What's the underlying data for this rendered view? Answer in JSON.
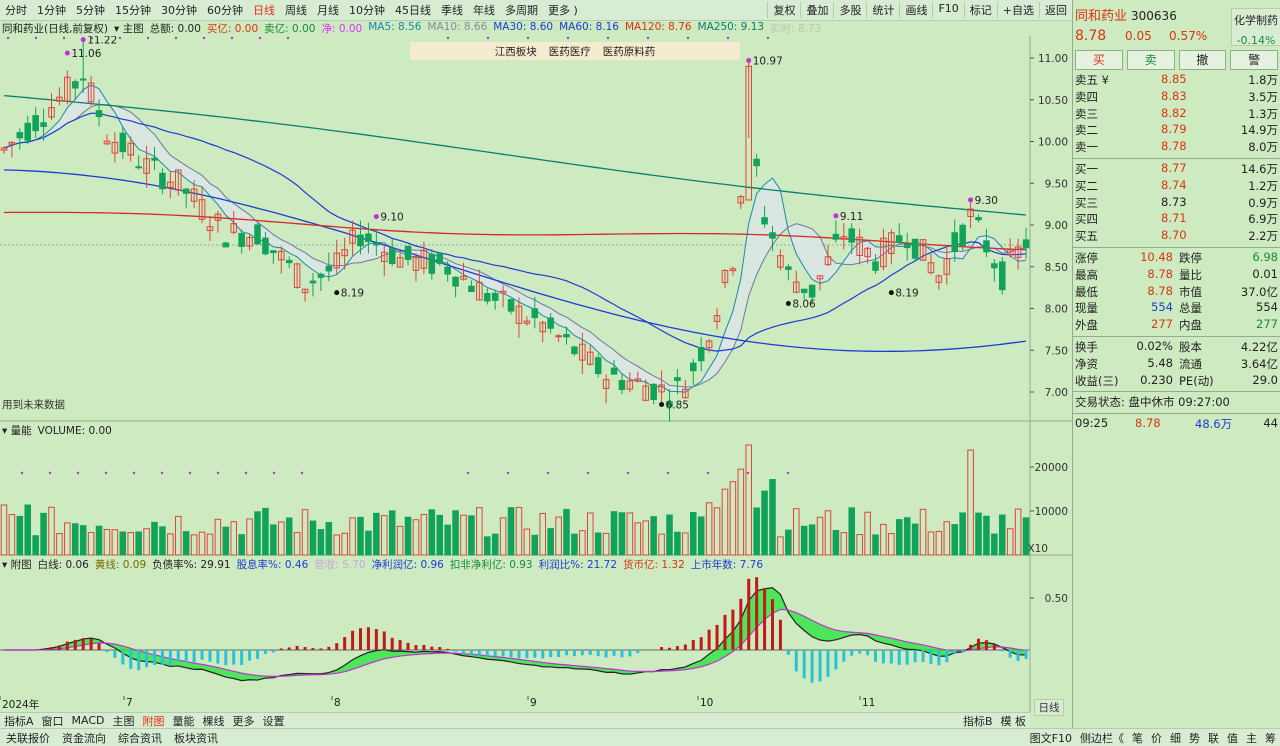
{
  "topbar": {
    "periods": [
      "分时",
      "1分钟",
      "5分钟",
      "15分钟",
      "30分钟",
      "60分钟",
      "日线",
      "周线",
      "月线",
      "10分钟",
      "45日线",
      "季线",
      "年线",
      "多周期",
      "更多 )"
    ],
    "active": "日线",
    "right": [
      "复权",
      "叠加",
      "多股",
      "统计",
      "画线",
      "F10",
      "标记",
      "+自选",
      "返回"
    ]
  },
  "legend": {
    "title": "同和药业(日线,前复权)",
    "zhutu": "▾ 主图",
    "zonge": "总额: 0.00",
    "mai": "买亿: 0.00",
    "mai2": "卖亿: 0.00",
    "jing": "净: 0.00",
    "ma5": "MA5: 8.56",
    "ma10": "MA10: 8.66",
    "ma30": "MA30: 8.60",
    "ma60": "MA60: 8.16",
    "ma120": "MA120: 8.76",
    "ma250": "MA250: 9.13",
    "shishi": "实时: 8.73"
  },
  "board": [
    "江西板块",
    "医药医疗",
    "医药原料药"
  ],
  "chart_data": {
    "type": "candlestick",
    "price_axis": [
      "11.00",
      "10.50",
      "10.00",
      "9.50",
      "9.00",
      "8.50",
      "8.00",
      "7.50",
      "7.00"
    ],
    "annotations": [
      "11.06",
      "11.22",
      "10.97",
      "9.30",
      "9.10",
      "9.11",
      "8.19",
      "8.06",
      "8.19",
      "6.85"
    ],
    "note": "用到未来数据",
    "vol_axis": [
      "20000",
      "10000"
    ],
    "vol_x": "X10",
    "fin_axis": "0.50",
    "dates": [
      "2024年",
      "7",
      "8",
      "9",
      "10",
      "11"
    ]
  },
  "vol": {
    "label": "▾ 量能",
    "text": "VOLUME: 0.00"
  },
  "fin": {
    "label": "▾ 附图",
    "baixian": "白线: 0.06",
    "huangxian": "黄线: 0.09",
    "fuzhai": "负债率%: 29.91",
    "guxi": "股息率%: 0.46",
    "yingshou": "营收: 5.70",
    "jinglirun": "净利润亿: 0.96",
    "koufei": "扣非净利亿: 0.93",
    "lirunbi": "利润比%: 21.72",
    "huobi": "货币亿: 1.32",
    "nianshu": "上市年数: 7.76"
  },
  "right_axis_label": "日线",
  "bottom_tabs": [
    "指标A",
    "窗口",
    "MACD",
    "主图",
    "附图",
    "量能",
    "棵线",
    "更多",
    "设置"
  ],
  "bottom_tabs_active": "附图",
  "bottom_right": [
    "指标B",
    "模 板"
  ],
  "status": [
    "关联报价",
    "资金流向",
    "综合资讯",
    "板块资讯"
  ],
  "status_right": [
    "图文F10",
    "侧边栏《",
    "笔",
    "价",
    "细",
    "势",
    "联",
    "值",
    "主",
    "筹"
  ],
  "quote": {
    "name": "同和药业",
    "code": "300636",
    "price": "8.78",
    "change": "0.05",
    "pct": "0.57%",
    "industry": "化学制药",
    "industry_pct": "-0.14%",
    "buttons": [
      "买",
      "卖",
      "撤",
      "警"
    ],
    "asks": [
      [
        "卖五 ¥",
        "8.85",
        "1.8万"
      ],
      [
        "卖四",
        "8.83",
        "3.5万"
      ],
      [
        "卖三",
        "8.82",
        "1.3万"
      ],
      [
        "卖二",
        "8.79",
        "14.9万"
      ],
      [
        "卖一",
        "8.78",
        "8.0万"
      ]
    ],
    "bids": [
      [
        "买一",
        "8.77",
        "14.6万"
      ],
      [
        "买二",
        "8.74",
        "1.2万"
      ],
      [
        "买三",
        "8.73",
        "0.9万"
      ],
      [
        "买四",
        "8.71",
        "6.9万"
      ],
      [
        "买五",
        "8.70",
        "2.2万"
      ]
    ],
    "stats": [
      [
        "涨停",
        "10.48",
        "跌停",
        "6.98"
      ],
      [
        "最高",
        "8.78",
        "量比",
        "0.01"
      ],
      [
        "最低",
        "8.78",
        "市值",
        "37.0亿"
      ],
      [
        "现量",
        "554",
        "总量",
        "554"
      ],
      [
        "外盘",
        "277",
        "内盘",
        "277"
      ]
    ],
    "stats2": [
      [
        "换手",
        "0.02%",
        "股本",
        "4.22亿"
      ],
      [
        "净资",
        "5.48",
        "流通",
        "3.64亿"
      ],
      [
        "收益(三)",
        "0.230",
        "PE(动)",
        "29.0"
      ]
    ],
    "trade_state": "交易状态: 盘中休市 09:27:00",
    "tick": [
      "09:25",
      "8.78",
      "48.6万",
      "44"
    ]
  }
}
